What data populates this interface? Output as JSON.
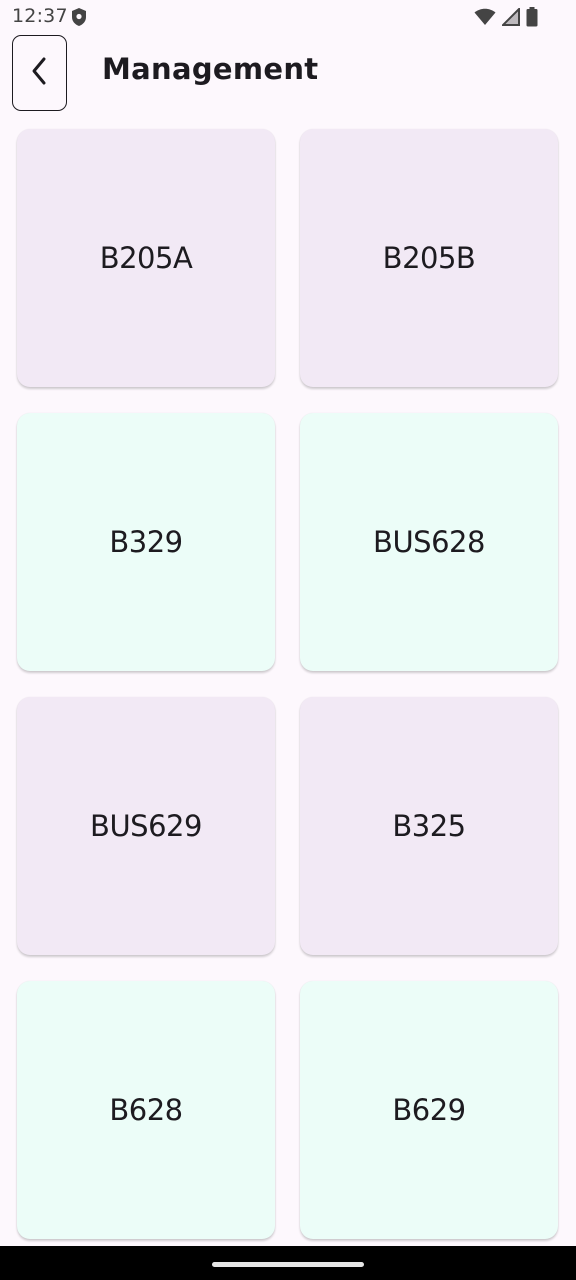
{
  "status_bar": {
    "time": "12:37",
    "icons": [
      "shield-icon",
      "wifi-icon",
      "signal-icon",
      "battery-icon"
    ]
  },
  "app_bar": {
    "back_icon": "chevron-left-icon",
    "title": "Management"
  },
  "grid": {
    "cards": [
      {
        "label": "B205A",
        "color": "#f2e9f5"
      },
      {
        "label": "B205B",
        "color": "#f2e9f5"
      },
      {
        "label": "B329",
        "color": "#ecfdf8"
      },
      {
        "label": "BUS628",
        "color": "#ecfdf8"
      },
      {
        "label": "BUS629",
        "color": "#f2e9f5"
      },
      {
        "label": "B325",
        "color": "#f2e9f5"
      },
      {
        "label": "B628",
        "color": "#ecfdf8"
      },
      {
        "label": "B629",
        "color": "#ecfdf8"
      }
    ]
  },
  "colors": {
    "background": "#fdf8fd",
    "card_purple": "#f2e9f5",
    "card_mint": "#ecfdf8",
    "text": "#1d1b20"
  }
}
